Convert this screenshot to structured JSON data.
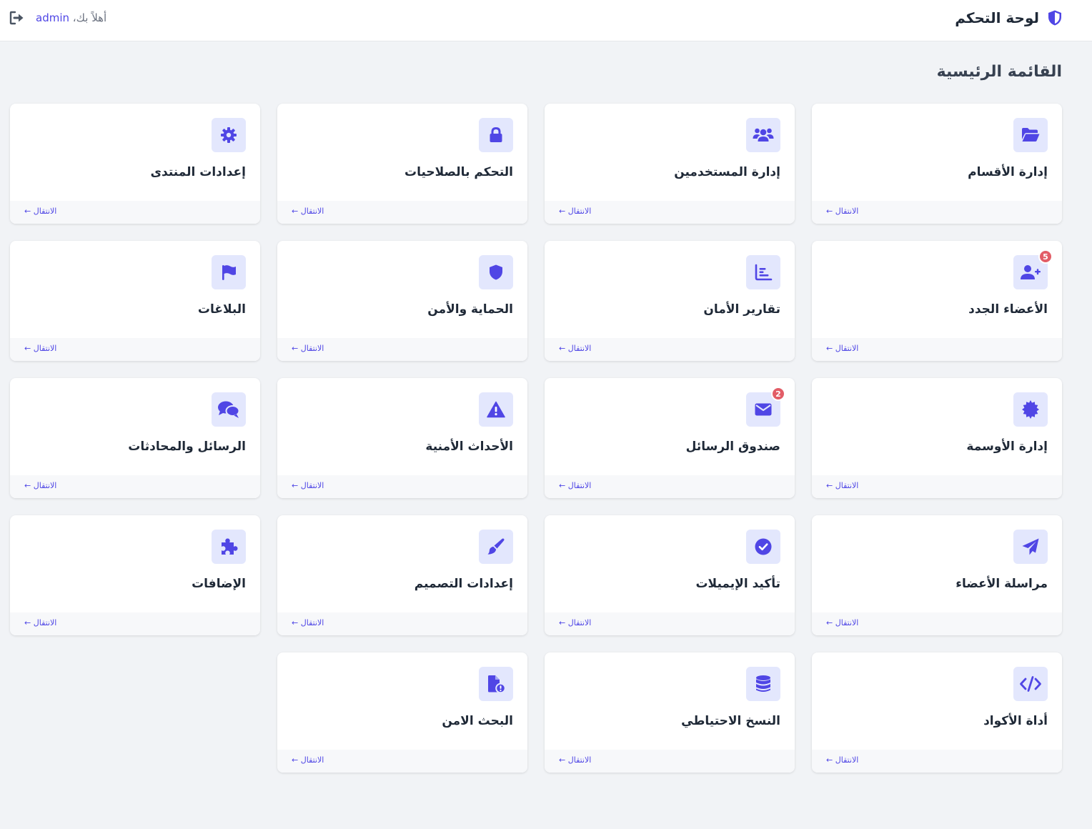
{
  "header": {
    "title": "لوحة التحكم",
    "greeting_prefix": "أهلاً بك، ",
    "username": "admin"
  },
  "page": {
    "title": "القائمة الرئيسية"
  },
  "theme": {
    "accent": "#4f46e5",
    "icon_bg": "#e3e7fd",
    "badge": "#e25d67",
    "background": "#f1f3f6"
  },
  "cards": [
    {
      "title": "إدارة الأقسام",
      "icon": "folder-open-icon",
      "link": "← الانتقال"
    },
    {
      "title": "إدارة المستخدمين",
      "icon": "users-icon",
      "link": "← الانتقال"
    },
    {
      "title": "التحكم بالصلاحيات",
      "icon": "lock-icon",
      "link": "← الانتقال"
    },
    {
      "title": "إعدادات المنتدى",
      "icon": "gear-icon",
      "link": "← الانتقال"
    },
    {
      "title": "الأعضاء الجدد",
      "icon": "user-plus-icon",
      "link": "← الانتقال",
      "badge": "5"
    },
    {
      "title": "تقارير الأمان",
      "icon": "chart-icon",
      "link": "← الانتقال"
    },
    {
      "title": "الحماية والأمن",
      "icon": "shield-icon",
      "link": "← الانتقال"
    },
    {
      "title": "البلاغات",
      "icon": "flag-icon",
      "link": "← الانتقال"
    },
    {
      "title": "إدارة الأوسمة",
      "icon": "certificate-icon",
      "link": "← الانتقال"
    },
    {
      "title": "صندوق الرسائل",
      "icon": "envelope-icon",
      "link": "← الانتقال",
      "badge": "2"
    },
    {
      "title": "الأحداث الأمنية",
      "icon": "warning-icon",
      "link": "← الانتقال"
    },
    {
      "title": "الرسائل والمحادثات",
      "icon": "comments-icon",
      "link": "← الانتقال"
    },
    {
      "title": "مراسلة الأعضاء",
      "icon": "paper-plane-icon",
      "link": "← الانتقال"
    },
    {
      "title": "تأكيد الإيميلات",
      "icon": "check-circle-icon",
      "link": "← الانتقال"
    },
    {
      "title": "إعدادات التصميم",
      "icon": "paintbrush-icon",
      "link": "← الانتقال"
    },
    {
      "title": "الإضافات",
      "icon": "puzzle-icon",
      "link": "← الانتقال"
    },
    {
      "title": "أداة الأكواد",
      "icon": "code-icon",
      "link": "← الانتقال"
    },
    {
      "title": "النسخ الاحتياطي",
      "icon": "database-icon",
      "link": "← الانتقال"
    },
    {
      "title": "البحث الامن",
      "icon": "file-alert-icon",
      "link": "← الانتقال"
    }
  ]
}
